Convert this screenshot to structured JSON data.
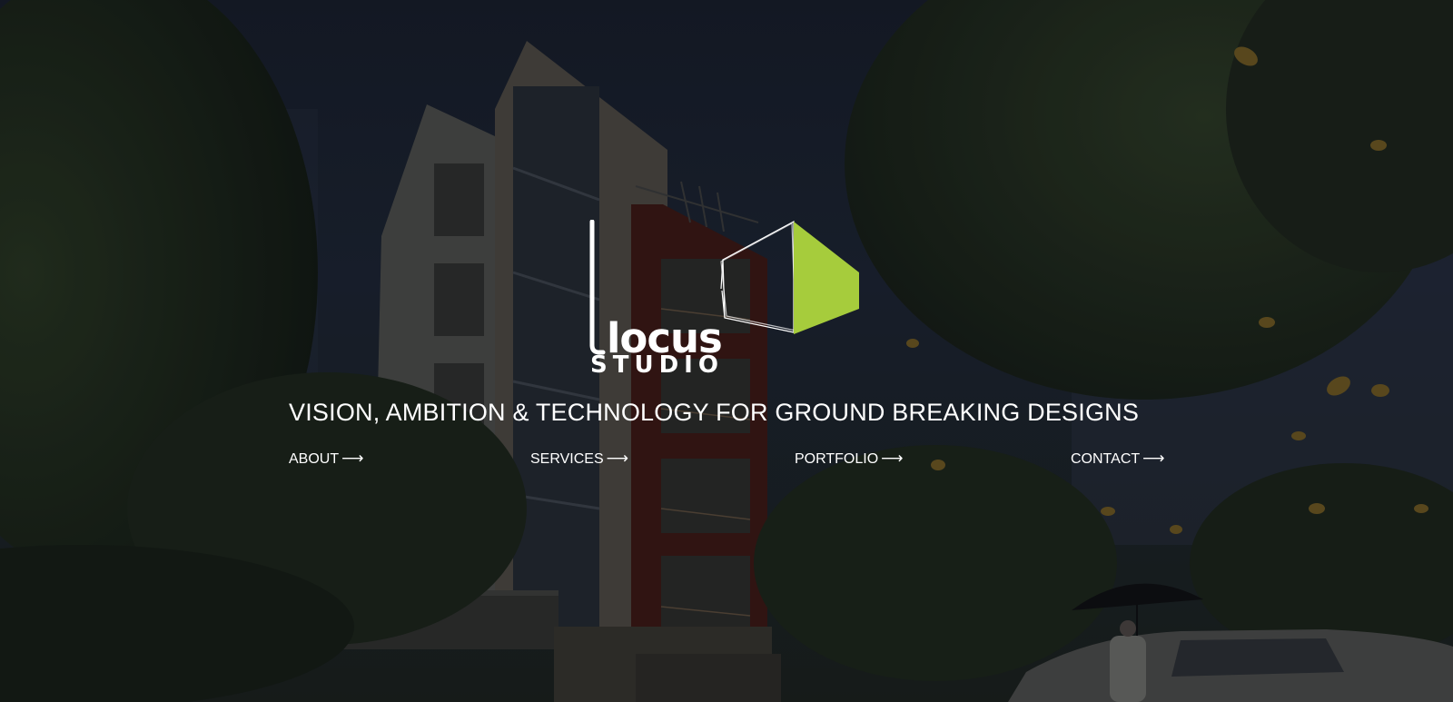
{
  "brand": {
    "logo_word": "locus",
    "logo_subword": "STUDIO",
    "accent_color": "#a6cc3c"
  },
  "tagline": "VISION, AMBITION & TECHNOLOGY FOR GROUND BREAKING DESIGNS",
  "nav": {
    "about": "ABOUT",
    "services": "SERVICES",
    "portfolio": "PORTFOLIO",
    "contact": "CONTACT",
    "arrow": "⟶"
  }
}
